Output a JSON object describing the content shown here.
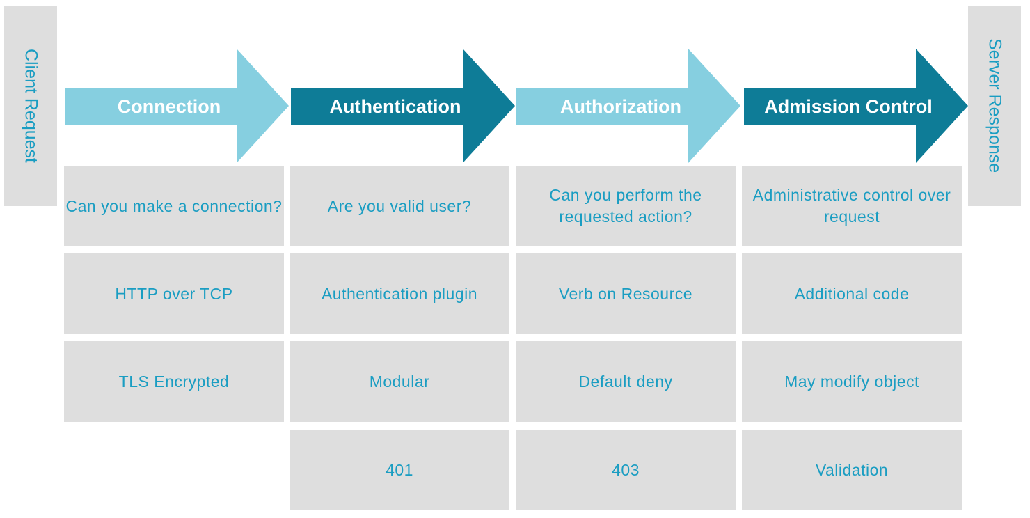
{
  "endpoints": {
    "start": "Client Request",
    "end": "Server Response"
  },
  "colors": {
    "light_arrow": "#86cfe0",
    "dark_arrow": "#0e7c97",
    "cell_bg": "#dedede",
    "cell_text": "#1a9dc2"
  },
  "stages": [
    {
      "name": "Connection",
      "style": "light",
      "rows": [
        "Can you make a connection?",
        "HTTP over TCP",
        "TLS Encrypted",
        ""
      ]
    },
    {
      "name": "Authentication",
      "style": "dark",
      "rows": [
        "Are you valid user?",
        "Authentication plugin",
        "Modular",
        "401"
      ]
    },
    {
      "name": "Authorization",
      "style": "light",
      "rows": [
        "Can you perform the requested action?",
        "Verb on Resource",
        "Default deny",
        "403"
      ]
    },
    {
      "name": "Admission Control",
      "style": "dark",
      "rows": [
        "Administrative control over request",
        "Additional code",
        "May modify object",
        "Validation"
      ]
    }
  ]
}
